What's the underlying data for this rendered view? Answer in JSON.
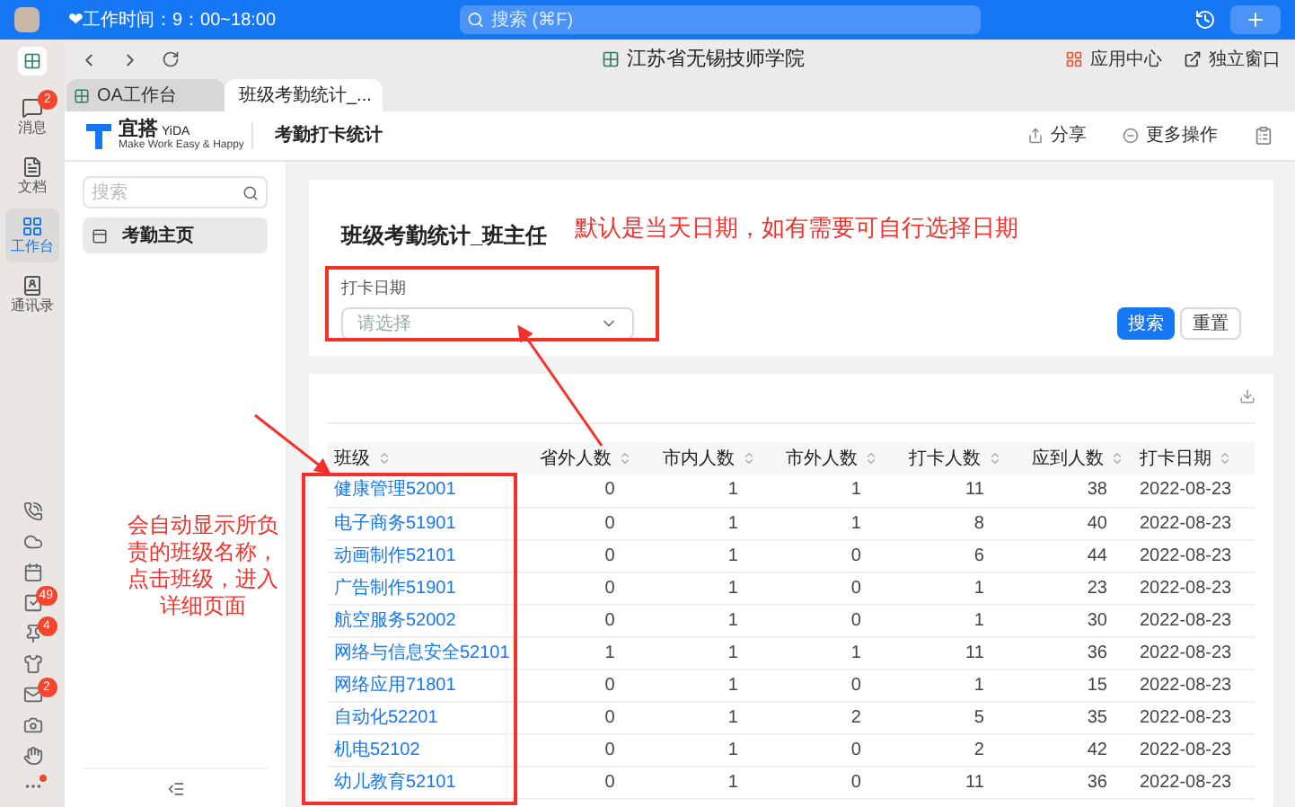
{
  "top_bar": {
    "work_time": "❤工作时间：9：00~18:00",
    "search": {
      "placeholder": "搜索 (⌘F)"
    }
  },
  "rail": {
    "items": [
      {
        "label": "消息",
        "badge": "2",
        "selected": false
      },
      {
        "label": "文档",
        "selected": false
      },
      {
        "label": "工作台",
        "selected": true
      },
      {
        "label": "通讯录",
        "selected": false
      }
    ],
    "bottom_icons": [
      {
        "kind": "phone",
        "dot": false
      },
      {
        "kind": "cloud",
        "dot": false
      },
      {
        "kind": "calendar",
        "dot": false
      },
      {
        "kind": "tasks",
        "badge": "49",
        "dot": false
      },
      {
        "kind": "pin",
        "badge": "4",
        "dot": false
      },
      {
        "kind": "shirt",
        "dot": false
      },
      {
        "kind": "mail",
        "badge": "2",
        "dot": false
      },
      {
        "kind": "camera",
        "dot": false
      },
      {
        "kind": "hand",
        "dot": false
      },
      {
        "kind": "more",
        "dot": true
      }
    ]
  },
  "toolbar": {
    "org_name": "江苏省无锡技师学院",
    "app_center": "应用中心",
    "standalone": "独立窗口"
  },
  "tabs": [
    {
      "label": "OA工作台",
      "selected": false
    },
    {
      "label": "班级考勤统计_...",
      "selected": true
    }
  ],
  "app_header": {
    "logo_text": "宜搭",
    "logo_sub": "YiDA",
    "tagline": "Make Work Easy & Happy",
    "page_title": "考勤打卡统计",
    "actions": [
      "分享",
      "更多操作"
    ]
  },
  "sidebar": {
    "search": {
      "placeholder": "搜索"
    },
    "items": [
      {
        "label": "考勤主页",
        "selected": true
      }
    ]
  },
  "form": {
    "title": "班级考勤统计_班主任",
    "field": {
      "label": "打卡日期",
      "placeholder": "请选择"
    },
    "buttons": [
      "搜索",
      "重置"
    ]
  },
  "table": {
    "columns": [
      "班级",
      "省外人数",
      "市内人数",
      "市外人数",
      "打卡人数",
      "应到人数",
      "打卡日期"
    ],
    "rows": [
      [
        "健康管理52001",
        "0",
        "1",
        "1",
        "11",
        "38",
        "2022-08-23"
      ],
      [
        "电子商务51901",
        "0",
        "1",
        "1",
        "8",
        "40",
        "2022-08-23"
      ],
      [
        "动画制作52101",
        "0",
        "1",
        "0",
        "6",
        "44",
        "2022-08-23"
      ],
      [
        "广告制作51901",
        "0",
        "1",
        "0",
        "1",
        "23",
        "2022-08-23"
      ],
      [
        "航空服务52002",
        "0",
        "1",
        "0",
        "1",
        "30",
        "2022-08-23"
      ],
      [
        "网络与信息安全52101",
        "1",
        "1",
        "1",
        "11",
        "36",
        "2022-08-23"
      ],
      [
        "网络应用71801",
        "0",
        "1",
        "0",
        "1",
        "15",
        "2022-08-23"
      ],
      [
        "自动化52201",
        "0",
        "1",
        "2",
        "5",
        "35",
        "2022-08-23"
      ],
      [
        "机电52102",
        "0",
        "1",
        "0",
        "2",
        "42",
        "2022-08-23"
      ],
      [
        "幼儿教育52101",
        "0",
        "1",
        "0",
        "11",
        "36",
        "2022-08-23"
      ]
    ]
  },
  "annotations": {
    "date_note": "默认是当天日期，如有需要可自行选择日期",
    "class_note": "会自动显示所负责的班级名称，点击班级，进入详细页面"
  }
}
